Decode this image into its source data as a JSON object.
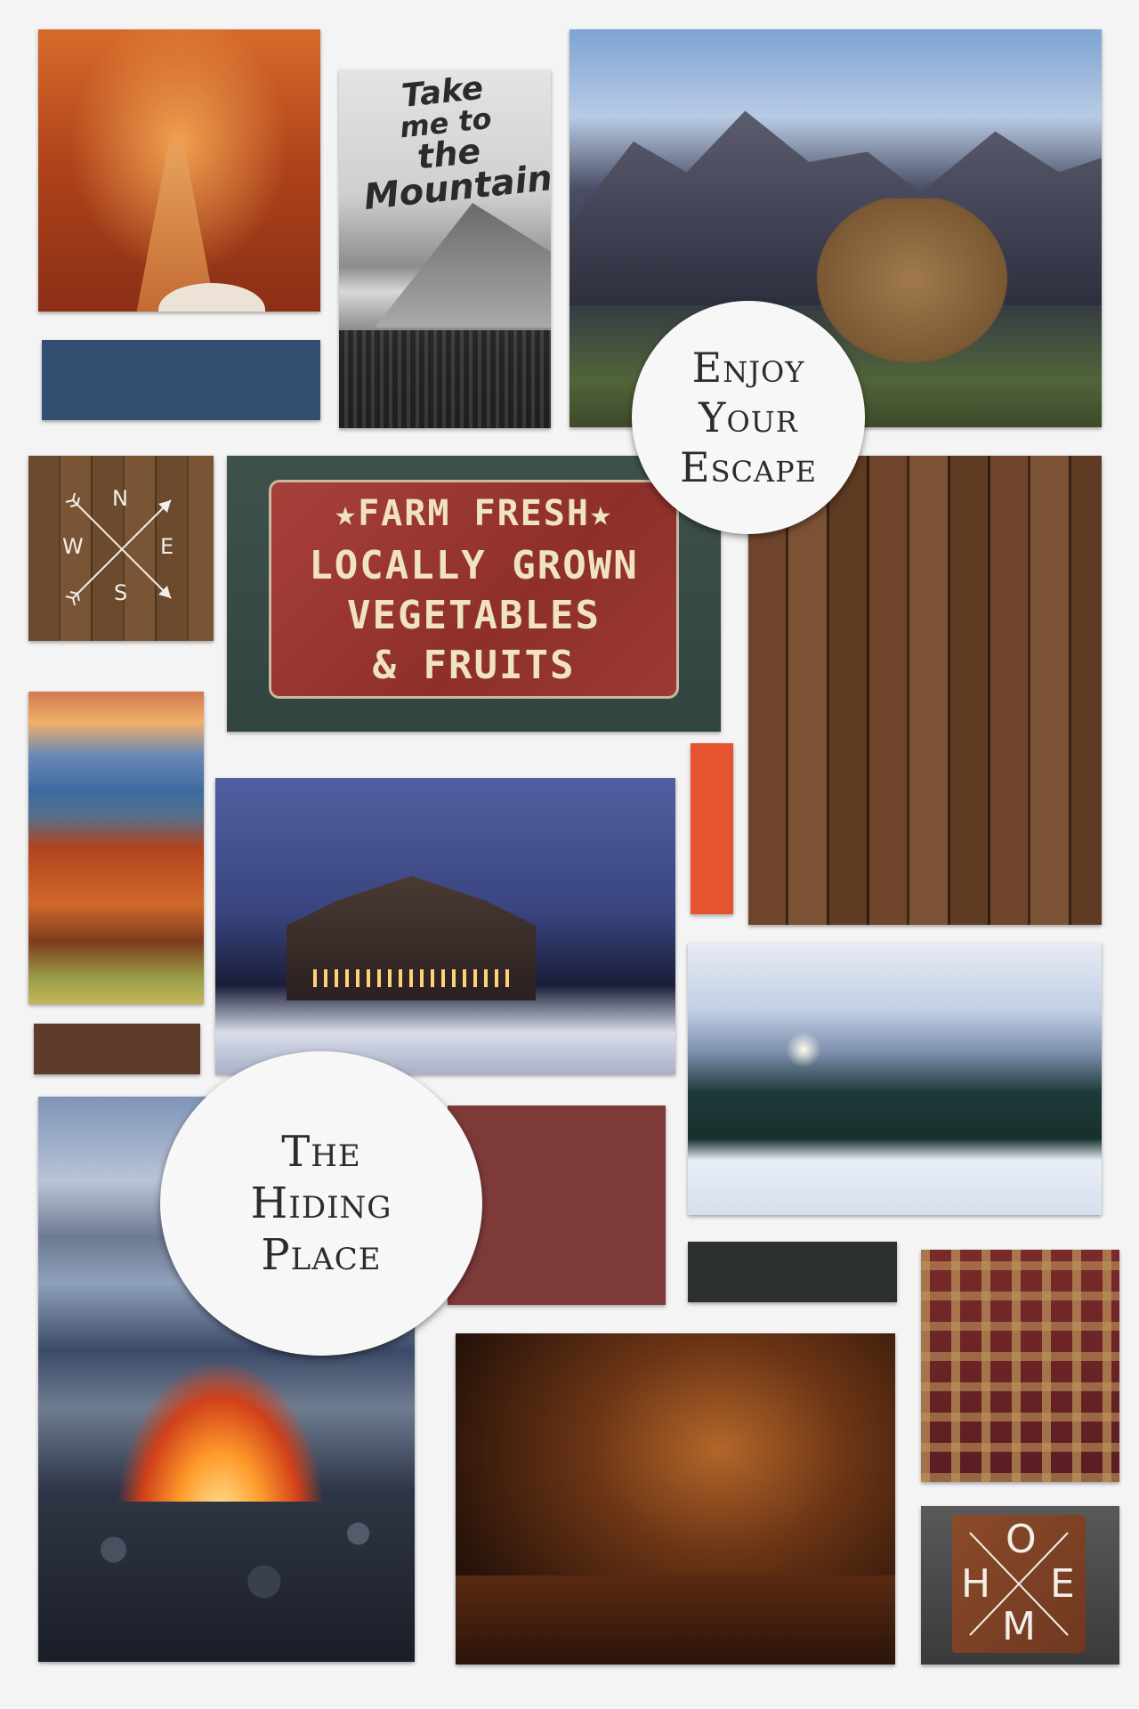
{
  "palette": {
    "blue": "#324f72",
    "orange": "#e5532f",
    "brown": "#5f3b2c",
    "red": "#7d3a39",
    "charcoal": "#2d312d"
  },
  "poster": {
    "line1": "Take",
    "line2": "me to",
    "line3": "the",
    "line4": "Mountains"
  },
  "farm_sign": {
    "line1": "★FARM FRESH★",
    "line2": "LOCALLY GROWN",
    "line3": "VEGETABLES",
    "line4": "& FRUITS"
  },
  "compass": {
    "n": "N",
    "s": "S",
    "e": "E",
    "w": "W"
  },
  "home_sign": {
    "h": "H",
    "o": "O",
    "m": "M",
    "e": "E"
  },
  "escape_circle": {
    "line1": "Enjoy",
    "line2": "Your",
    "line3": "Escape"
  },
  "hiding_circle": {
    "line1": "The",
    "line2": "Hiding",
    "line3": "Place"
  }
}
